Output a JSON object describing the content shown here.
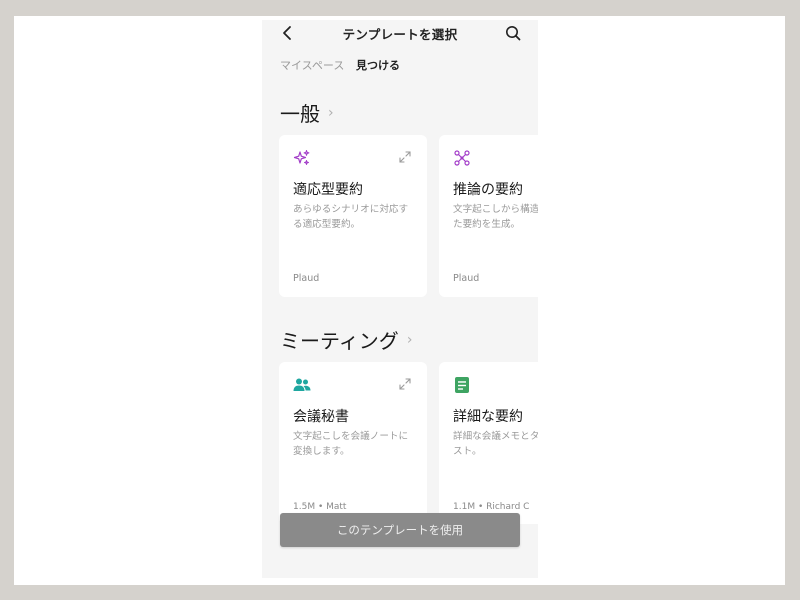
{
  "header": {
    "title": "テンプレートを選択",
    "back_icon": "chevron-left-icon",
    "search_icon": "search-icon"
  },
  "tabs": [
    {
      "label": "マイスペース",
      "active": false
    },
    {
      "label": "見つける",
      "active": true
    }
  ],
  "sections": [
    {
      "title": "一般",
      "cards": [
        {
          "title": "適応型要約",
          "description": "あらゆるシナリオに対応する適応型要約。",
          "author": "Plaud",
          "icon": "sparkles-icon",
          "icon_color": "#a23cc8"
        },
        {
          "title": "推論の要約",
          "description": "文字起こしから構造化された要約を生成。",
          "author": "Plaud",
          "icon": "nodes-icon",
          "icon_color": "#a23cc8"
        }
      ]
    },
    {
      "title": "ミーティング",
      "cards": [
        {
          "title": "会議秘書",
          "description": "文字起こしを会議ノートに変換します。",
          "meta": "1.5M • Matt",
          "icon": "people-icon",
          "icon_color": "#1fa7a0"
        },
        {
          "title": "詳細な要約",
          "description": "詳細な会議メモとタスクリスト。",
          "meta": "1.1M • Richard C",
          "icon": "document-icon",
          "icon_color": "#3ea462"
        }
      ]
    }
  ],
  "use_button_label": "このテンプレートを使用"
}
